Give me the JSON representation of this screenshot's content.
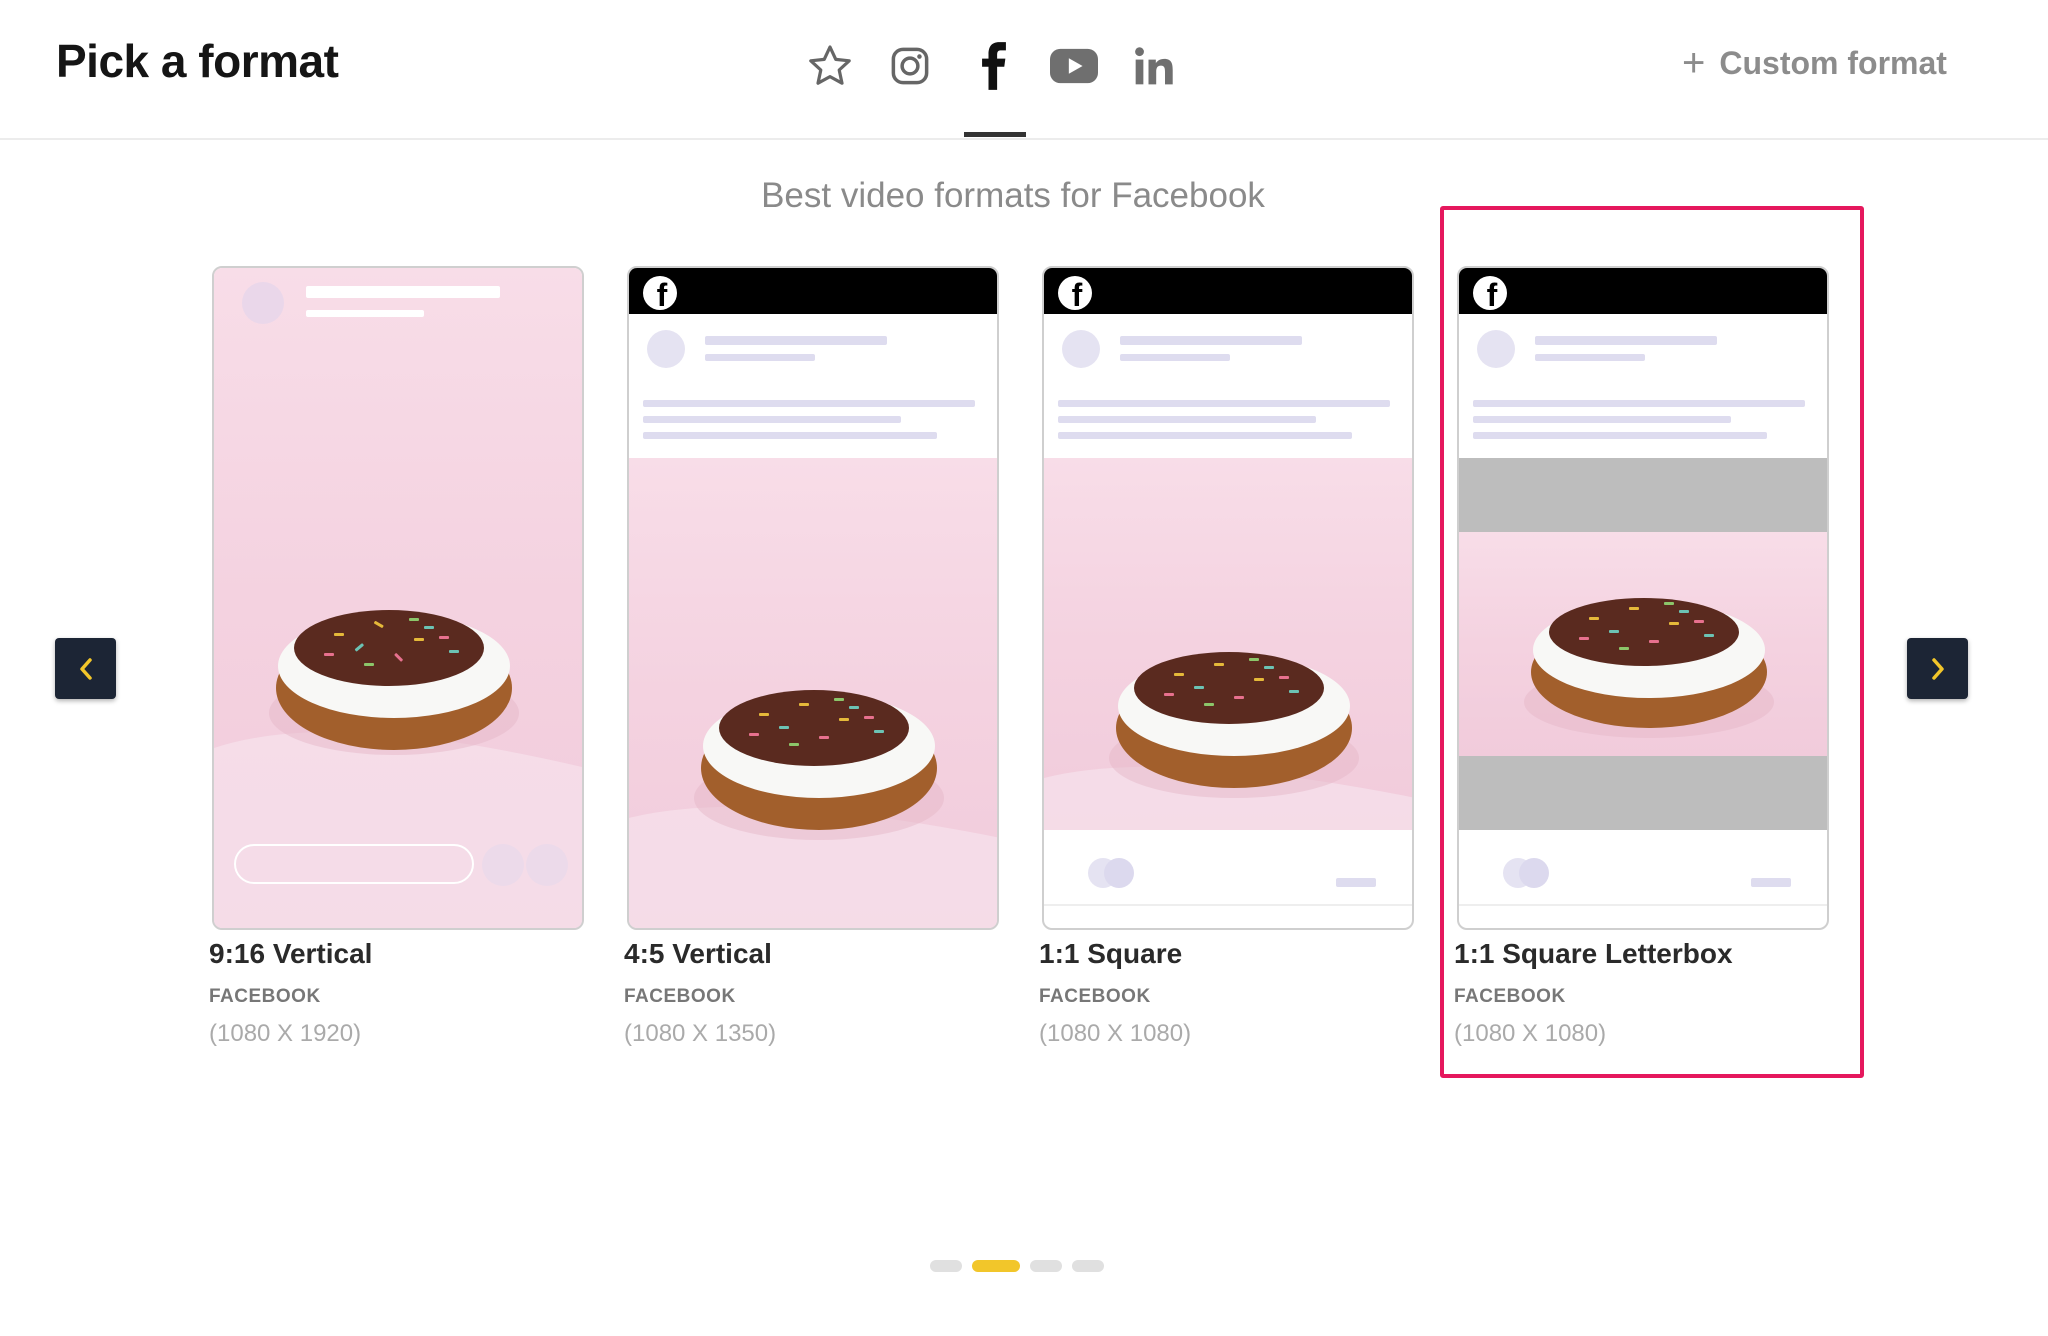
{
  "header": {
    "title": "Pick a format",
    "custom_format": "Custom format",
    "nav": [
      {
        "icon": "star-icon",
        "active": false
      },
      {
        "icon": "instagram-icon",
        "active": false
      },
      {
        "icon": "facebook-icon",
        "active": true
      },
      {
        "icon": "youtube-icon",
        "active": false
      },
      {
        "icon": "linkedin-icon",
        "active": false
      }
    ]
  },
  "subtitle": "Best video formats for Facebook",
  "formats": [
    {
      "name": "9:16 Vertical",
      "platform": "FACEBOOK",
      "dimensions": "(1080 X 1920)"
    },
    {
      "name": "4:5 Vertical",
      "platform": "FACEBOOK",
      "dimensions": "(1080 X 1350)"
    },
    {
      "name": "1:1 Square",
      "platform": "FACEBOOK",
      "dimensions": "(1080 X 1080)"
    },
    {
      "name": "1:1 Square Letterbox",
      "platform": "FACEBOOK",
      "dimensions": "(1080 X 1080)",
      "selected": true
    }
  ],
  "pagination": {
    "pages": 4,
    "active": 2
  },
  "colors": {
    "accent": "#f2c62a",
    "highlight": "#e5185d",
    "arrow_bg": "#1c2535"
  }
}
